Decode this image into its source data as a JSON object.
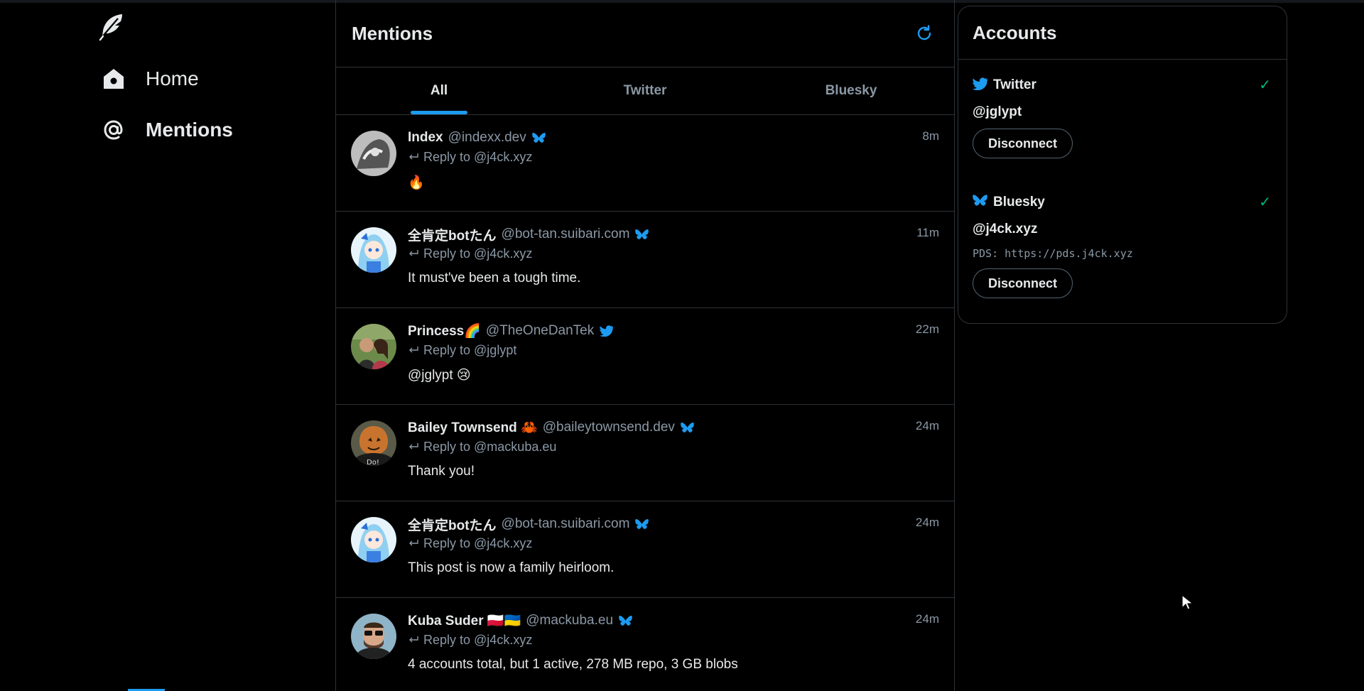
{
  "nav": {
    "items": [
      {
        "label": "Home",
        "icon": "home-icon"
      },
      {
        "label": "Mentions",
        "icon": "at-icon"
      }
    ]
  },
  "center": {
    "title": "Mentions",
    "tabs": [
      "All",
      "Twitter",
      "Bluesky"
    ],
    "active_tab": "All"
  },
  "posts": [
    {
      "name": "Index",
      "handle": "@indexx.dev",
      "network": "bluesky",
      "time": "8m",
      "reply_to": "Reply to @j4ck.xyz",
      "text": "🔥"
    },
    {
      "name": "全肯定botたん",
      "handle": "@bot-tan.suibari.com",
      "network": "bluesky",
      "time": "11m",
      "reply_to": "Reply to @j4ck.xyz",
      "text": "It must've been a tough time."
    },
    {
      "name": "Princess🌈",
      "handle": "@TheOneDanTek",
      "network": "twitter",
      "time": "22m",
      "reply_to": "Reply to @jglypt",
      "text": "@jglypt 😢"
    },
    {
      "name": "Bailey Townsend 🦀",
      "handle": "@baileytownsend.dev",
      "network": "bluesky",
      "time": "24m",
      "reply_to": "Reply to @mackuba.eu",
      "text": "Thank you!"
    },
    {
      "name": "全肯定botたん",
      "handle": "@bot-tan.suibari.com",
      "network": "bluesky",
      "time": "24m",
      "reply_to": "Reply to @j4ck.xyz",
      "text": "This post is now a family heirloom."
    },
    {
      "name": "Kuba Suder 🇵🇱🇺🇦",
      "handle": "@mackuba.eu",
      "network": "bluesky",
      "time": "24m",
      "reply_to": "Reply to @j4ck.xyz",
      "text": "4 accounts total, but 1 active, 278 MB repo, 3 GB blobs"
    }
  ],
  "accounts": {
    "title": "Accounts",
    "items": [
      {
        "service": "Twitter",
        "handle": "@jglypt",
        "check": "✓",
        "disconnect": "Disconnect"
      },
      {
        "service": "Bluesky",
        "handle": "@j4ck.xyz",
        "pds": "PDS: https://pds.j4ck.xyz",
        "check": "✓",
        "disconnect": "Disconnect"
      }
    ]
  },
  "colors": {
    "accent": "#1d9bf0",
    "background": "#000000",
    "border": "#2f3336",
    "muted_text": "#8b98a5",
    "check": "#00ba7c"
  }
}
